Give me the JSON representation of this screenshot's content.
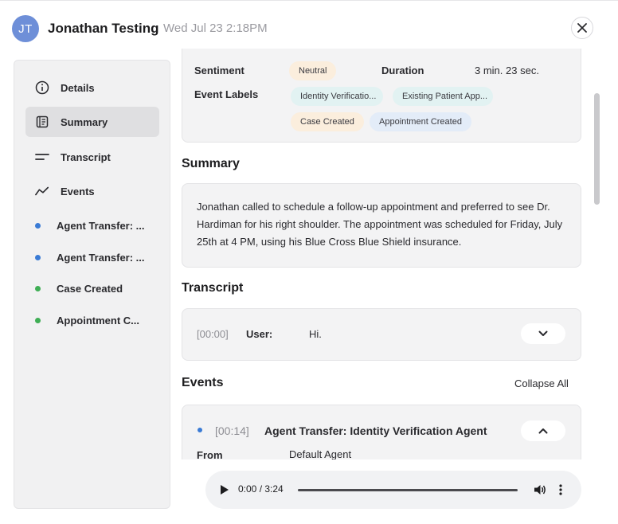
{
  "header": {
    "avatar_initials": "JT",
    "title": "Jonathan Testing",
    "date": "Wed Jul 23 2:18PM"
  },
  "sidebar": {
    "items": [
      {
        "label": "Details",
        "icon": "info-icon"
      },
      {
        "label": "Summary",
        "icon": "document-icon",
        "active": true
      },
      {
        "label": "Transcript",
        "icon": "lines-icon"
      },
      {
        "label": "Events",
        "icon": "trend-icon"
      },
      {
        "label": "Agent Transfer: ...",
        "dot_color": "#3a7bd5"
      },
      {
        "label": "Agent Transfer: ...",
        "dot_color": "#3a7bd5"
      },
      {
        "label": "Case Created",
        "dot_color": "#3fae55"
      },
      {
        "label": "Appointment C...",
        "dot_color": "#3fae55"
      }
    ]
  },
  "details": {
    "sentiment_label": "Sentiment",
    "sentiment_value": "Neutral",
    "duration_label": "Duration",
    "duration_value": "3 min. 23 sec.",
    "event_labels_label": "Event Labels",
    "chips": [
      "Identity Verificatio...",
      "Existing Patient App...",
      "Case Created",
      "Appointment Created"
    ]
  },
  "summary": {
    "heading": "Summary",
    "text": "Jonathan called to schedule a follow-up appointment and preferred to see Dr. Hardiman for his right shoulder. The appointment was scheduled for Friday, July 25th at 4 PM, using his Blue Cross Blue Shield insurance."
  },
  "transcript": {
    "heading": "Transcript",
    "timestamp": "[00:00]",
    "speaker": "User:",
    "message": "Hi."
  },
  "events": {
    "heading": "Events",
    "collapse_all": "Collapse All",
    "first": {
      "timestamp": "[00:14]",
      "title": "Agent Transfer: Identity Verification Agent",
      "from_label": "From",
      "from_value": "Default Agent"
    }
  },
  "audio": {
    "time": "0:00 / 3:24",
    "progress": 0
  },
  "colors": {
    "chip_orange": "#fbeedd",
    "chip_blue": "#e3ecf8",
    "chip_teal": "#e2f2f2",
    "dot_blue": "#3a7bd5",
    "dot_green": "#3fae55"
  }
}
